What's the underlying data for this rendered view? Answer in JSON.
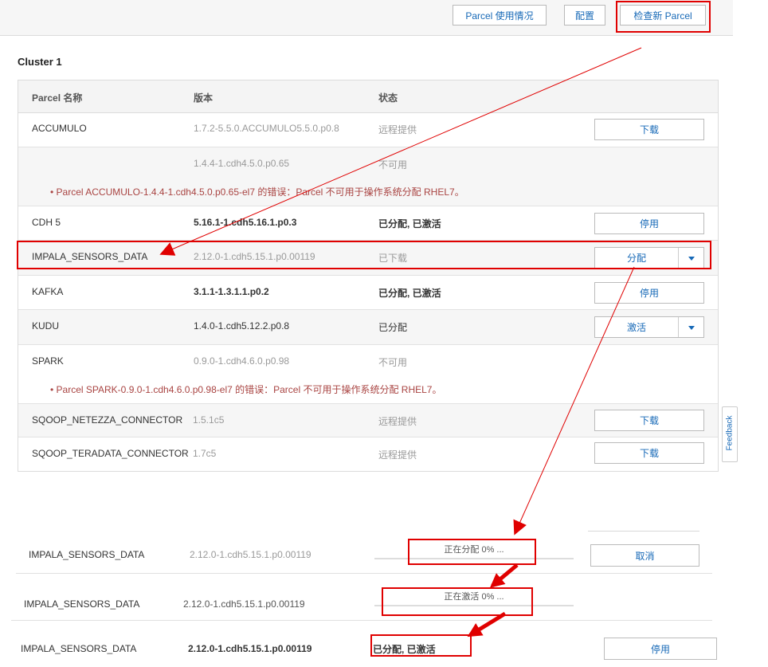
{
  "toolbar": {
    "usage_label": "Parcel 使用情况",
    "config_label": "配置",
    "check_label": "检查新 Parcel"
  },
  "cluster": {
    "title": "Cluster 1",
    "headers": {
      "name": "Parcel 名称",
      "version": "版本",
      "status": "状态"
    },
    "rows": [
      {
        "name": "ACCUMULO",
        "version": "1.7.2-5.5.0.ACCUMULO5.5.0.p0.8",
        "status": "远程提供",
        "action": "下载"
      },
      {
        "name": "",
        "version": "1.4.4-1.cdh4.5.0.p0.65",
        "status": "不可用",
        "error": "Parcel ACCUMULO-1.4.4-1.cdh4.5.0.p0.65-el7 的错误：Parcel 不可用于操作系统分配 RHEL7。"
      },
      {
        "name": "CDH 5",
        "version": "5.16.1-1.cdh5.16.1.p0.3",
        "status": "已分配, 已激活",
        "action": "停用"
      },
      {
        "name": "IMPALA_SENSORS_DATA",
        "version": "2.12.0-1.cdh5.15.1.p0.00119",
        "status": "已下载",
        "action": "分配"
      },
      {
        "name": "KAFKA",
        "version": "3.1.1-1.3.1.1.p0.2",
        "status": "已分配, 已激活",
        "action": "停用"
      },
      {
        "name": "KUDU",
        "version": "1.4.0-1.cdh5.12.2.p0.8",
        "status": "已分配",
        "action": "激活"
      },
      {
        "name": "SPARK",
        "version": "0.9.0-1.cdh4.6.0.p0.98",
        "status": "不可用",
        "error": "Parcel SPARK-0.9.0-1.cdh4.6.0.p0.98-el7 的错误：Parcel 不可用于操作系统分配 RHEL7。"
      },
      {
        "name": "SQOOP_NETEZZA_CONNECTOR",
        "version": "1.5.1c5",
        "status": "远程提供",
        "action": "下载"
      },
      {
        "name": "SQOOP_TERADATA_CONNECTOR",
        "version": "1.7c5",
        "status": "远程提供",
        "action": "下载"
      }
    ]
  },
  "feedback_label": "Feedback",
  "progress_rows": [
    {
      "name": "IMPALA_SENSORS_DATA",
      "version": "2.12.0-1.cdh5.15.1.p0.00119",
      "status": "正在分配 0% ...",
      "action": "取消"
    },
    {
      "name": "IMPALA_SENSORS_DATA",
      "version": "2.12.0-1.cdh5.15.1.p0.00119",
      "status": "正在激活 0% ..."
    },
    {
      "name": "IMPALA_SENSORS_DATA",
      "version": "2.12.0-1.cdh5.15.1.p0.00119",
      "status": "已分配, 已激活",
      "action": "停用"
    }
  ],
  "colors": {
    "annotation": "#e00000",
    "link": "#1769b7",
    "error": "#a94442"
  }
}
